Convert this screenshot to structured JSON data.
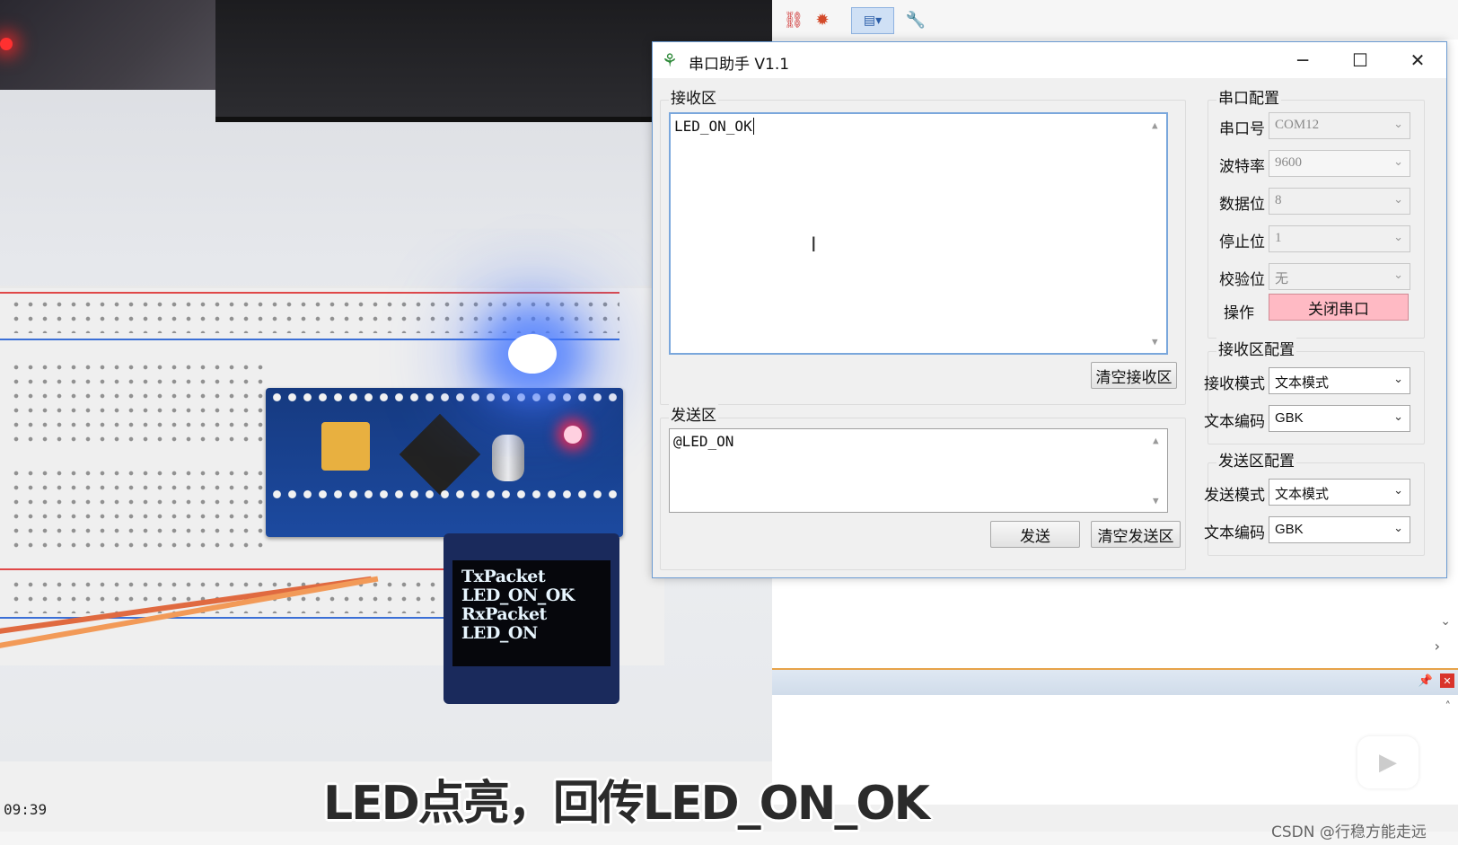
{
  "app": {
    "title": "串口助手 V1.1",
    "minimize": "─",
    "maximize": "☐",
    "close": "✕"
  },
  "receive": {
    "group_title": "接收区",
    "content": "LED_ON_OK",
    "clear_button": "清空接收区"
  },
  "send": {
    "group_title": "发送区",
    "content": "@LED_ON",
    "send_button": "发送",
    "clear_button": "清空发送区"
  },
  "serial_config": {
    "group_title": "串口配置",
    "port_label": "串口号",
    "port_value": "COM12",
    "baud_label": "波特率",
    "baud_value": "9600",
    "databits_label": "数据位",
    "databits_value": "8",
    "stopbits_label": "停止位",
    "stopbits_value": "1",
    "parity_label": "校验位",
    "parity_value": "无",
    "operation_label": "操作",
    "operation_button": "关闭串口"
  },
  "receive_config": {
    "group_title": "接收区配置",
    "mode_label": "接收模式",
    "mode_value": "文本模式",
    "encoding_label": "文本编码",
    "encoding_value": "GBK"
  },
  "send_config": {
    "group_title": "发送区配置",
    "mode_label": "发送模式",
    "mode_value": "文本模式",
    "encoding_label": "文本编码",
    "encoding_value": "GBK"
  },
  "oled": {
    "lines": [
      "TxPacket",
      "LED_ON_OK",
      "RxPacket",
      "LED_ON"
    ]
  },
  "overlay": {
    "subtitle": "LED点亮，回传LED_ON_OK",
    "timecode": "09:39",
    "watermark": "CSDN @行稳方能走远"
  },
  "icons": {
    "app": "app-logo-icon",
    "toolbar": [
      "link-icon",
      "debug-icon",
      "view-icon",
      "wrench-icon"
    ]
  },
  "colors": {
    "close_port_button": "#ffbac4",
    "focus_border": "#7aa7dc",
    "blue_led": "#4678ff",
    "red_led": "#ff2850"
  }
}
